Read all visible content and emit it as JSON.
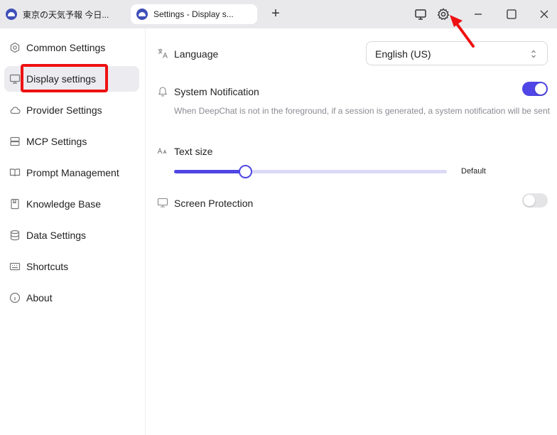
{
  "tabs": [
    {
      "title": "東京の天気予報 今日..."
    },
    {
      "title": "Settings - Display s..."
    }
  ],
  "new_tab_label": "+",
  "sidebar": {
    "items": [
      {
        "label": "Common Settings",
        "icon": "hexagon-settings-icon"
      },
      {
        "label": "Display settings",
        "icon": "monitor-icon"
      },
      {
        "label": "Provider Settings",
        "icon": "cloud-icon"
      },
      {
        "label": "MCP Settings",
        "icon": "server-icon"
      },
      {
        "label": "Prompt Management",
        "icon": "book-open-icon"
      },
      {
        "label": "Knowledge Base",
        "icon": "book-icon"
      },
      {
        "label": "Data Settings",
        "icon": "database-icon"
      },
      {
        "label": "Shortcuts",
        "icon": "keyboard-icon"
      },
      {
        "label": "About",
        "icon": "info-icon"
      }
    ],
    "active_index": 1
  },
  "settings": {
    "language": {
      "label": "Language",
      "value": "English (US)"
    },
    "notification": {
      "label": "System Notification",
      "enabled": true,
      "description": "When DeepChat is not in the foreground, if a session is generated, a system notification will be sent"
    },
    "text_size": {
      "label": "Text size",
      "value_label": "Default",
      "level": 0.26
    },
    "screen_protection": {
      "label": "Screen Protection",
      "enabled": false
    }
  },
  "colors": {
    "accent": "#4f46e5",
    "annotation": "#ee1111"
  }
}
